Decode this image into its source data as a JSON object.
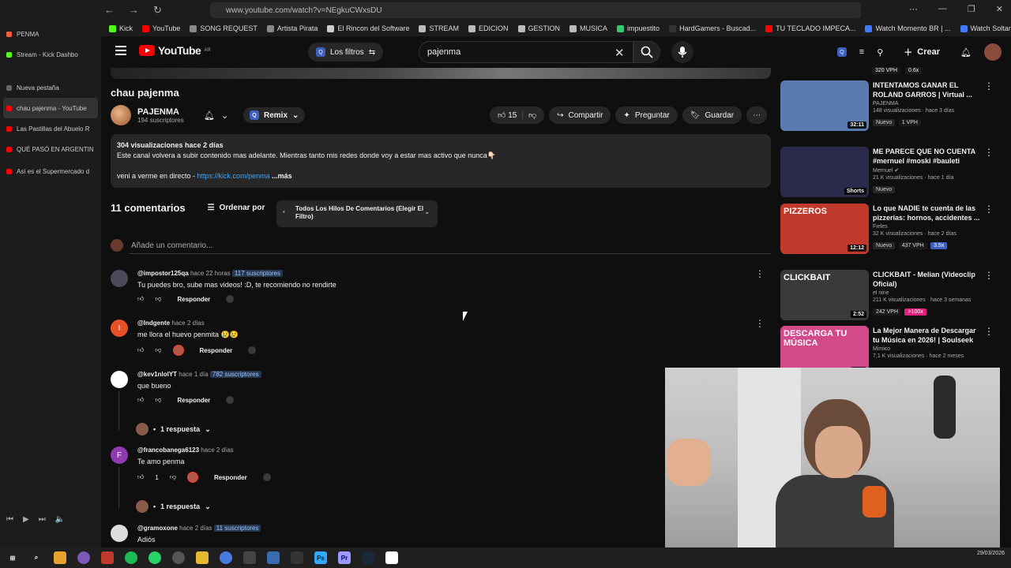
{
  "browser": {
    "url": "www.youtube.com/watch?v=NEgkuCWxsDU",
    "bookmarks": [
      {
        "label": "Kick",
        "color": "#53fc18"
      },
      {
        "label": "YouTube",
        "color": "#ff0000"
      },
      {
        "label": "SONG REQUEST",
        "color": "#888888"
      },
      {
        "label": "Artista Pirata",
        "color": "#888888"
      },
      {
        "label": "El Rincon del Software",
        "color": "#cccccc"
      },
      {
        "label": "STREAM",
        "color": "#bbbbbb"
      },
      {
        "label": "EDICION",
        "color": "#bbbbbb"
      },
      {
        "label": "GESTION",
        "color": "#bbbbbb"
      },
      {
        "label": "MUSICA",
        "color": "#bbbbbb"
      },
      {
        "label": "impuestito",
        "color": "#2ecc71"
      },
      {
        "label": "HardGamers - Buscad...",
        "color": "#333333"
      },
      {
        "label": "TU TECLADO IMPECA...",
        "color": "#ff0000"
      },
      {
        "label": "Watch Momento BR | ...",
        "color": "#3d7bff"
      },
      {
        "label": "Watch Soltando magi...",
        "color": "#3d7bff"
      },
      {
        "label": "Embed Generator",
        "color": "#3d7bff"
      }
    ],
    "sidebar": [
      {
        "label": "PENMA",
        "color": "#ff5a3c"
      },
      {
        "label": "Stream - Kick Dashbo",
        "color": "#53fc18"
      },
      {
        "label": "Nueva pestaña",
        "color": "#666666"
      },
      {
        "label": "chau pajenma - YouTube",
        "color": "#ff0000",
        "active": true
      },
      {
        "label": "Las Pastillas del Abuelo R",
        "color": "#ff0000"
      },
      {
        "label": "QUÉ PASÓ EN ARGENTIN",
        "color": "#ff0000"
      },
      {
        "label": "Así es el Supermercado d",
        "color": "#ff0000"
      }
    ]
  },
  "yt": {
    "logo_text": "YouTube",
    "logo_country": "AR",
    "filters_label": "Los filtros",
    "search_value": "pajenma",
    "create_label": "Crear"
  },
  "video": {
    "title": "chau pajenma",
    "channel": "PAJENMA",
    "subscribers": "194 suscriptores",
    "remix_label": "Remix",
    "likes": "15",
    "share_label": "Compartir",
    "ask_label": "Preguntar",
    "save_label": "Guardar",
    "desc_stats": "304 visualizaciones  hace 2 días",
    "desc_line1": "Este canal volvera a subir contenido mas adelante. Mientras tanto mis redes donde voy a estar mas activo que nunca👇🏻",
    "desc_line2_prefix": "veni a verme en directo - ",
    "desc_link": "https://kick.com/penma",
    "desc_more": "...más"
  },
  "comments": {
    "count_label": "11 comentarios",
    "sort_label": "Ordenar por",
    "thread_filter": "Todos Los Hilos De Comentarios (Elegir El Filtro)",
    "add_placeholder": "Añade un comentario...",
    "reply_label": "Responder",
    "items": [
      {
        "author": "@impostor125qa",
        "time": "hace 22 horas",
        "subs": "117 suscriptores",
        "text": "Tu puedes bro, sube mas videos! :D, te recomiendo no rendirte",
        "likes": "",
        "avatar_color": "#4a4a5a"
      },
      {
        "author": "@lndgente",
        "time": "hace 2 días",
        "subs": "",
        "text": "me llora el huevo penmita 😢😢",
        "likes": "",
        "avatar_color": "#e8502a",
        "avatar_letter": "I"
      },
      {
        "author": "@kev1nlolYT",
        "time": "hace 1 día",
        "subs": "782 suscriptores",
        "text": "que bueno",
        "likes": "",
        "avatar_color": "#ffffff",
        "replies": "1 respuesta"
      },
      {
        "author": "@francobanega6123",
        "time": "hace 2 días",
        "subs": "",
        "text": "Te amo penma",
        "likes": "1",
        "avatar_color": "#8e3ab0",
        "avatar_letter": "F",
        "replies": "1 respuesta"
      },
      {
        "author": "@gramoxone",
        "time": "hace 2 días",
        "subs": "11 suscriptores",
        "text": "Adiós",
        "likes": "",
        "avatar_color": "#dddddd"
      }
    ]
  },
  "recommendations": {
    "top_stats": [
      "320 VPH",
      "0.6x"
    ],
    "items": [
      {
        "title": "INTENTAMOS GANAR EL ROLAND GARROS | Virtual ...",
        "channel": "PAJENMA",
        "meta": "148 visualizaciones · hace 3 días",
        "duration": "32:11",
        "badges": [
          "Nuevo",
          "1 VPH"
        ],
        "thumb": "#5a7ab0"
      },
      {
        "title": "ME PARECE QUE NO CUENTA #mernuel #moski #bauleti",
        "channel": "Mernuel ✔",
        "meta": "21 K visualizaciones · hace 1 día",
        "duration": "Shorts",
        "badges": [
          "Nuevo"
        ],
        "thumb": "#2a2a4a"
      },
      {
        "title": "Lo que NADIE te cuenta de las pizzerías: hornos, accidentes ...",
        "channel": "Fieles",
        "meta": "32 K visualizaciones · hace 2 días",
        "duration": "12:12",
        "badges": [
          "Nuevo",
          "437 VPH",
          "3.5x"
        ],
        "thumb": "#c0392b",
        "thumb_text": "PIZZEROS"
      },
      {
        "title": "CLICKBAIT - Melian (Videoclip Oficial)",
        "channel": "el nine",
        "meta": "211 K visualizaciones · hace 3 semanas",
        "duration": "2:52",
        "badges": [
          "242 VPH",
          ">100x"
        ],
        "thumb": "#3a3a3a",
        "thumb_text": "CLICKBAIT"
      },
      {
        "title": "La Mejor Manera de Descargar tu Música en 2026! | Soulseek",
        "channel": "Mimico",
        "meta": "7,1 K visualizaciones · hace 2 meses",
        "duration": "3:46",
        "badges": [],
        "thumb": "#d24a8a",
        "thumb_text": "DESCARGA TU MÚSICA"
      }
    ]
  },
  "taskbar": {
    "date": "29/03/2026"
  }
}
